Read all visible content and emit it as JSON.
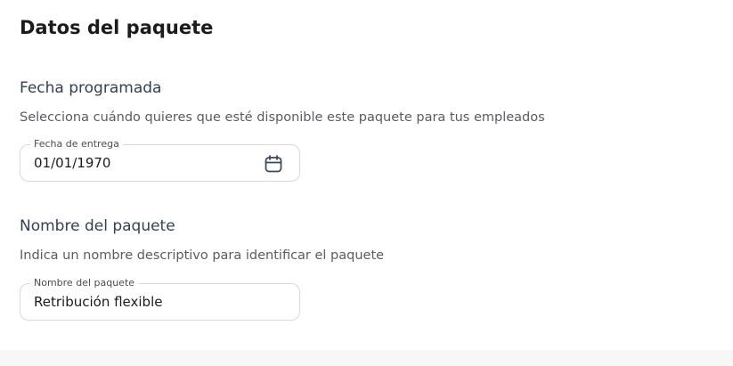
{
  "page": {
    "title": "Datos del paquete"
  },
  "scheduled_date": {
    "heading": "Fecha programada",
    "description": "Selecciona cuándo quieres que esté disponible este paquete para tus empleados",
    "field_label": "Fecha de entrega",
    "field_value": "01/01/1970",
    "icon": "calendar-icon"
  },
  "package_name": {
    "heading": "Nombre del paquete",
    "description": "Indica un nombre descriptivo para identificar el paquete",
    "field_label": "Nombre del paquete",
    "field_value": "Retribución flexible"
  },
  "colors": {
    "heading": "#334155",
    "border": "#d9d9de",
    "footer_background": "#f7f7f8"
  }
}
